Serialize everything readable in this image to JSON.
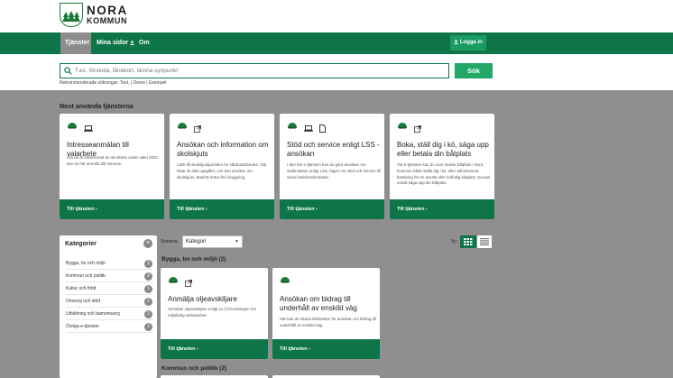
{
  "logo": {
    "line1": "NORA",
    "line2": "KOMMUN"
  },
  "nav": {
    "items": [
      {
        "label": "Tjänster"
      },
      {
        "label": "Mina sidor"
      },
      {
        "label": "Om"
      }
    ],
    "login": "Logga in"
  },
  "search": {
    "placeholder": "T.ex. förskola, lånekort, lämna synpunkt",
    "button": "Sök",
    "recommended": "Rekommenderade sökningar: Test, | Demo | Exempel"
  },
  "most_used": {
    "title": "Mest använda tjänsterna",
    "cards": [
      {
        "title": "Intresseanmälan till valarbete",
        "desc": "Om du är intresserad av att arbeta under valet 2022 kan du här anmäla ditt intresse.",
        "link": "Till tjänsten"
      },
      {
        "title": "Ansökan och information om skolskjuts",
        "desc": "Länk till skolskjutsportalen för vårdnadshavare. Där hittar du alla uppgifter, och kan ansöka, om skolskjuts. BankID krävs för inloggning.",
        "link": "Till tjänsten"
      },
      {
        "title": "Stöd och service enligt LSS - ansökan",
        "desc": "I den här e-tjänsten kan du göra ansökan om stödinsatser enligt LSS, lagen om stöd och service till vissa funktionshindrade.",
        "link": "Till tjänsten"
      },
      {
        "title": "Boka, ställ dig i kö, säga upp eller betala din båtplats",
        "desc": "Via E-tjänsten kan du som önskar båtplats i Nora kommun både ställa dig i kö, eller administrera betalning för en ansökt eller befintlig båtplats. Du kan också säga upp din båtplats.",
        "link": "Till tjänsten"
      }
    ]
  },
  "categories": {
    "title": "Kategorier",
    "items": [
      {
        "label": "Bygga, bo och miljö",
        "count": "2"
      },
      {
        "label": "Kommun och politik",
        "count": "2"
      },
      {
        "label": "Kultur och fritid",
        "count": "1"
      },
      {
        "label": "Omsorg och stöd",
        "count": "2"
      },
      {
        "label": "Utbildning och barnomsorg",
        "count": "2"
      },
      {
        "label": "Övriga e-tjänster",
        "count": "1"
      }
    ]
  },
  "sort": {
    "label": "Sortera:",
    "value": "Kategori"
  },
  "view": {
    "label": "Vy:"
  },
  "groups": [
    {
      "title": "Bygga, bo och miljö (2)",
      "cards": [
        {
          "title": "Anmälja oljeavskiljare",
          "desc": "Anmälan oljeavskiljare enligt 11 § förordningen om miljöfarlig verksamhet.",
          "link": "Till tjänsten"
        },
        {
          "title": "Ansökan om bidrag till underhåll av enskild väg",
          "desc": "Här kan du hämta blanketten för ansökan om bidrag till underhåll av enskild väg.",
          "link": "Till tjänsten"
        }
      ]
    },
    {
      "title": "Kommun och politik (2)"
    }
  ],
  "colors": {
    "brand_green": "#0e7548",
    "button_green": "#23a766",
    "background_gray": "#8f8f8f"
  }
}
